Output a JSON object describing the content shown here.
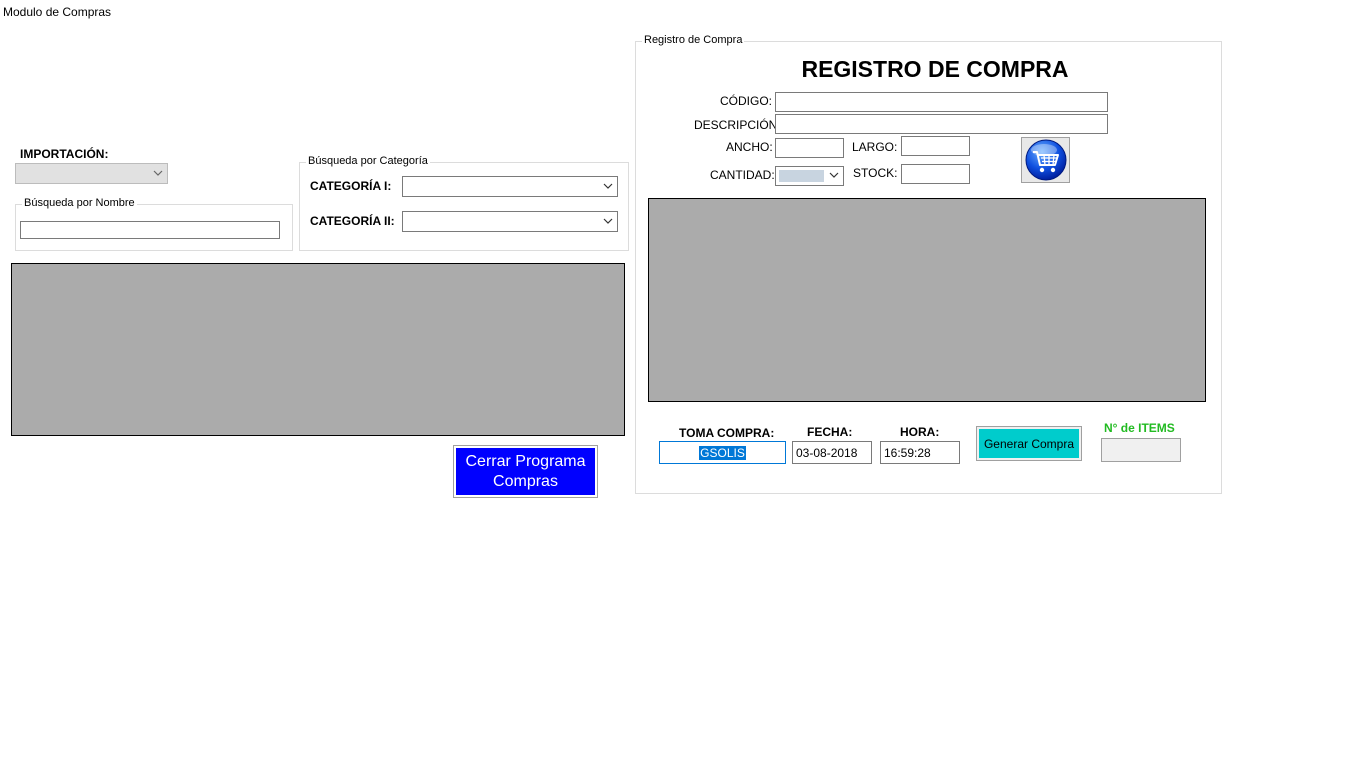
{
  "window": {
    "title": "Modulo de Compras"
  },
  "left": {
    "importacion_label": "IMPORTACIÓN:",
    "nombre_group": {
      "legend": "Búsqueda por Nombre",
      "value": ""
    },
    "categoria_group": {
      "legend": "Búsqueda por Categoría",
      "cat1_label": "CATEGORÍA I:",
      "cat2_label": "CATEGORÍA II:"
    },
    "close_button": {
      "line1": "Cerrar Programa",
      "line2": "Compras"
    }
  },
  "registro": {
    "legend": "Registro de Compra",
    "heading": "REGISTRO DE COMPRA",
    "codigo_label": "CÓDIGO:",
    "descripcion_label": "DESCRIPCIÓN:",
    "ancho_label": "ANCHO:",
    "largo_label": "LARGO:",
    "cantidad_label": "CANTIDAD:",
    "stock_label": "STOCK:",
    "toma_compra_label": "TOMA COMPRA:",
    "toma_compra_value": "GSOLIS",
    "fecha_label": "FECHA:",
    "fecha_value": "03-08-2018",
    "hora_label": "HORA:",
    "hora_value": "16:59:28",
    "generar_button": "Generar Compra",
    "items_label": "N° de ITEMS"
  },
  "colors": {
    "close_button_bg": "#0000ff",
    "generar_button_bg": "#00cccc",
    "items_label_color": "#22bb22",
    "grid_bg": "#ababab"
  },
  "icons": {
    "cart": "shopping-cart-icon",
    "dropdown": "chevron-down-icon"
  }
}
